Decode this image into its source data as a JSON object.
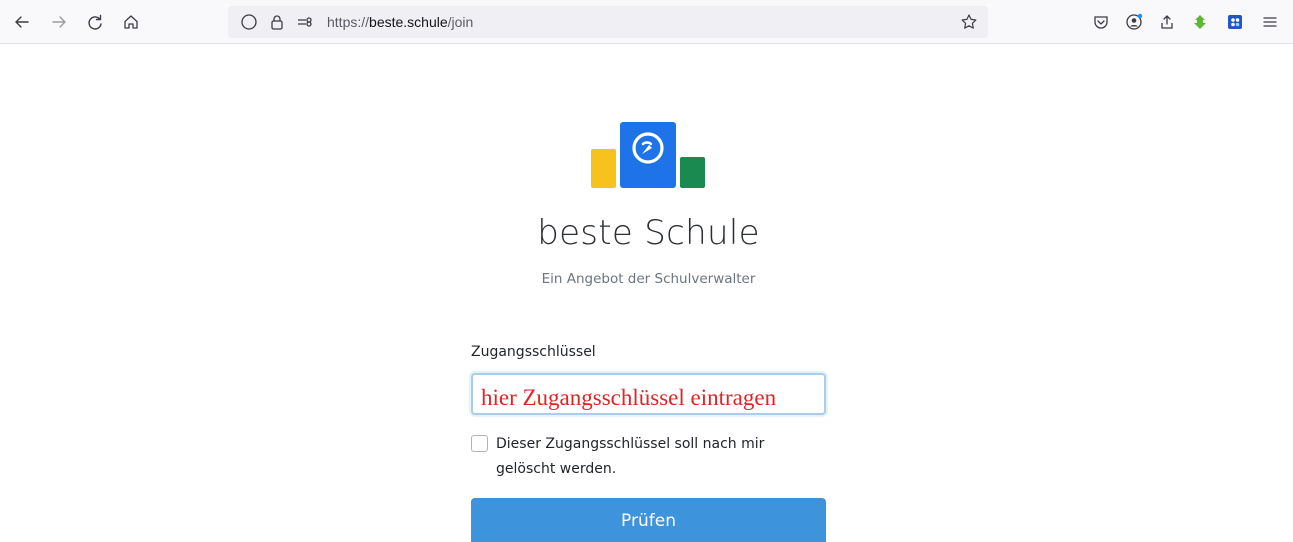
{
  "browser": {
    "url_prefix": "https://",
    "url_host": "beste.schule",
    "url_path": "/join",
    "icons": [
      "back-icon",
      "forward-icon",
      "reload-icon",
      "home-icon",
      "shield-icon",
      "lock-icon",
      "permissions-icon",
      "bookmark-star-icon",
      "pocket-icon",
      "account-icon",
      "share-icon",
      "download-extension-icon",
      "extension-icon",
      "menu-icon"
    ]
  },
  "brand": {
    "title": "beste Schule",
    "subtitle": "Ein Angebot der Schulverwalter",
    "colors": {
      "yellow": "#f8c21c",
      "blue": "#1e73e8",
      "green": "#1b8a4f"
    }
  },
  "form": {
    "key_label": "Zugangsschlüssel",
    "key_placeholder": "hier Zugangsschlüssel eintragen",
    "delete_checkbox_label": "Dieser Zugangsschlüssel soll nach mir gelöscht werden.",
    "delete_checked": false,
    "submit_label": "Prüfen",
    "submit_color": "#3d93dc"
  }
}
